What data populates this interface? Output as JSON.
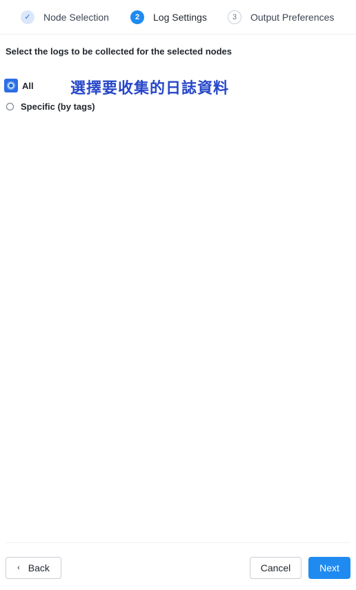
{
  "stepper": {
    "steps": [
      {
        "label": "Node Selection",
        "marker": "✓",
        "state": "done"
      },
      {
        "label": "Log Settings",
        "marker": "2",
        "state": "active"
      },
      {
        "label": "Output Preferences",
        "marker": "3",
        "state": "pending"
      }
    ]
  },
  "content": {
    "instruction": "Select the logs to be collected for the selected nodes",
    "annotation": "選擇要收集的日誌資料",
    "options": [
      {
        "label": "All",
        "selected": true
      },
      {
        "label": "Specific (by tags)",
        "selected": false
      }
    ]
  },
  "footer": {
    "back_icon": "‹",
    "back_label": "Back",
    "cancel_label": "Cancel",
    "next_label": "Next"
  },
  "colors": {
    "primary": "#1f8bf0",
    "annotation": "#2747c9",
    "selected_highlight": "#2c6ee6"
  }
}
